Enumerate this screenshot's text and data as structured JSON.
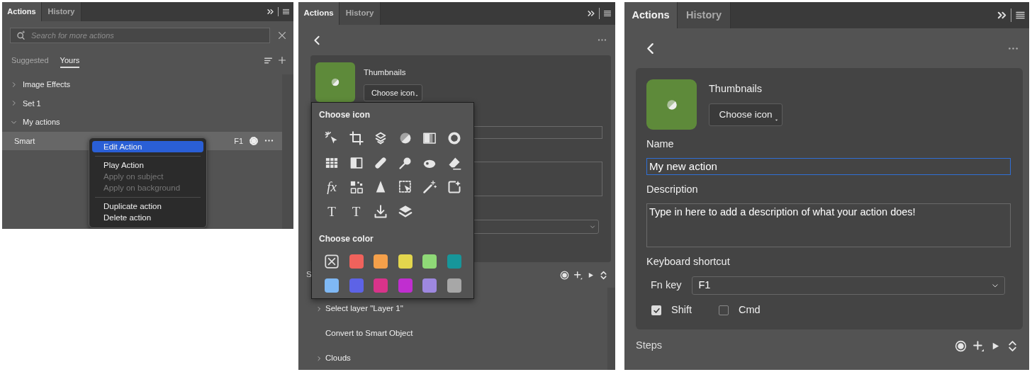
{
  "panels": [
    {
      "kind": "browse",
      "tabs": [
        {
          "label": "Actions",
          "selected": true
        },
        {
          "label": "History",
          "selected": false
        }
      ],
      "search": {
        "placeholder": "Search for more actions"
      },
      "subtabs": [
        {
          "label": "Suggested",
          "selected": false
        },
        {
          "label": "Yours",
          "selected": true
        }
      ],
      "tree": [
        {
          "label": "Image Effects",
          "expanded": false
        },
        {
          "label": "Set 1",
          "expanded": false
        },
        {
          "label": "My actions",
          "expanded": true,
          "children": [
            {
              "label": "Smart",
              "shortcut": "F1",
              "selected": true
            }
          ]
        }
      ],
      "context_menu": [
        [
          {
            "label": "Edit Action",
            "selected": true,
            "disabled": false
          }
        ],
        [
          {
            "label": "Play Action",
            "selected": false,
            "disabled": false
          },
          {
            "label": "Apply on subject",
            "selected": false,
            "disabled": true
          },
          {
            "label": "Apply on background",
            "selected": false,
            "disabled": true
          }
        ],
        [
          {
            "label": "Duplicate action",
            "selected": false,
            "disabled": false
          },
          {
            "label": "Delete action",
            "selected": false,
            "disabled": false
          }
        ]
      ]
    },
    {
      "kind": "icon_picker",
      "tabs": [
        {
          "label": "Actions",
          "selected": true
        },
        {
          "label": "History",
          "selected": false
        }
      ],
      "thumbnail_label": "Thumbnails",
      "choose_button": "Choose icon",
      "popover": {
        "icon_heading": "Choose icon",
        "icon_glyphs": [
          "fx",
          "T",
          "T"
        ],
        "color_heading": "Choose color",
        "swatches": [
          {
            "kind": "none"
          },
          {
            "kind": "color",
            "color": "#f0625c"
          },
          {
            "kind": "color",
            "color": "#f5a04a"
          },
          {
            "kind": "color",
            "color": "#e3d64d"
          },
          {
            "kind": "color",
            "color": "#8fd977"
          },
          {
            "kind": "color",
            "color": "#17969a"
          },
          {
            "kind": "color",
            "color": "#7fb8f5"
          },
          {
            "kind": "color",
            "color": "#5d63e6"
          },
          {
            "kind": "color",
            "color": "#d8338a"
          },
          {
            "kind": "color",
            "color": "#c02ed0"
          },
          {
            "kind": "color",
            "color": "#9e88e0"
          },
          {
            "kind": "color",
            "color": "#a7a7a7"
          }
        ]
      },
      "steps_title": "S",
      "steps": [
        {
          "label": "Select layer \"Layer 1\"",
          "expandable": true
        },
        {
          "label": "Convert to Smart Object",
          "expandable": false
        },
        {
          "label": "Clouds",
          "expandable": true
        }
      ]
    },
    {
      "kind": "editor",
      "tabs": [
        {
          "label": "Actions",
          "selected": true
        },
        {
          "label": "History",
          "selected": false
        }
      ],
      "thumbnail_label": "Thumbnails",
      "choose_button": "Choose icon",
      "name": {
        "label": "Name",
        "value": "My new action",
        "focused": true
      },
      "description": {
        "label": "Description",
        "value": "Type in here to add a description of what your action does!"
      },
      "shortcut": {
        "label": "Keyboard shortcut",
        "fn_label": "Fn key",
        "fn_value": "F1",
        "modifiers": [
          {
            "label": "Shift",
            "checked": true
          },
          {
            "label": "Cmd",
            "checked": false
          }
        ]
      },
      "steps_title": "Steps"
    }
  ]
}
